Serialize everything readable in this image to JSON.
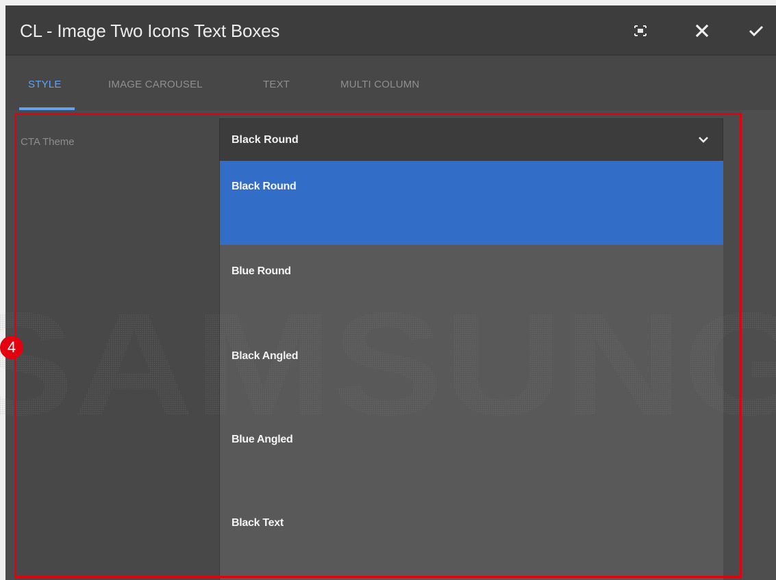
{
  "dialog": {
    "title": "CL - Image Two Icons Text Boxes",
    "toolbar": {
      "fullscreen_icon": "fullscreen-icon",
      "close_icon": "close-icon",
      "confirm_icon": "checkmark-icon"
    }
  },
  "tabs": [
    {
      "label": "STYLE",
      "active": true
    },
    {
      "label": "IMAGE CAROUSEL",
      "active": false
    },
    {
      "label": "TEXT",
      "active": false
    },
    {
      "label": "MULTI COLUMN",
      "active": false
    }
  ],
  "form": {
    "cta_theme": {
      "label": "CTA Theme",
      "selected": "Black Round",
      "chevron_icon": "chevron-down-icon",
      "options": [
        {
          "label": "Black Round",
          "selected": true
        },
        {
          "label": "Blue Round",
          "selected": false
        },
        {
          "label": "Black Angled",
          "selected": false
        },
        {
          "label": "Blue Angled",
          "selected": false
        },
        {
          "label": "Black Text",
          "selected": false
        }
      ]
    }
  },
  "annotation": {
    "step_number": "4",
    "color": "#e3000f"
  },
  "watermark": {
    "text": "SAMSUNG"
  },
  "colors": {
    "accent": "#5ea4f2",
    "selected_option": "#326ec8",
    "titlebar": "#3d3d3d",
    "panel": "#4a4a4a"
  }
}
